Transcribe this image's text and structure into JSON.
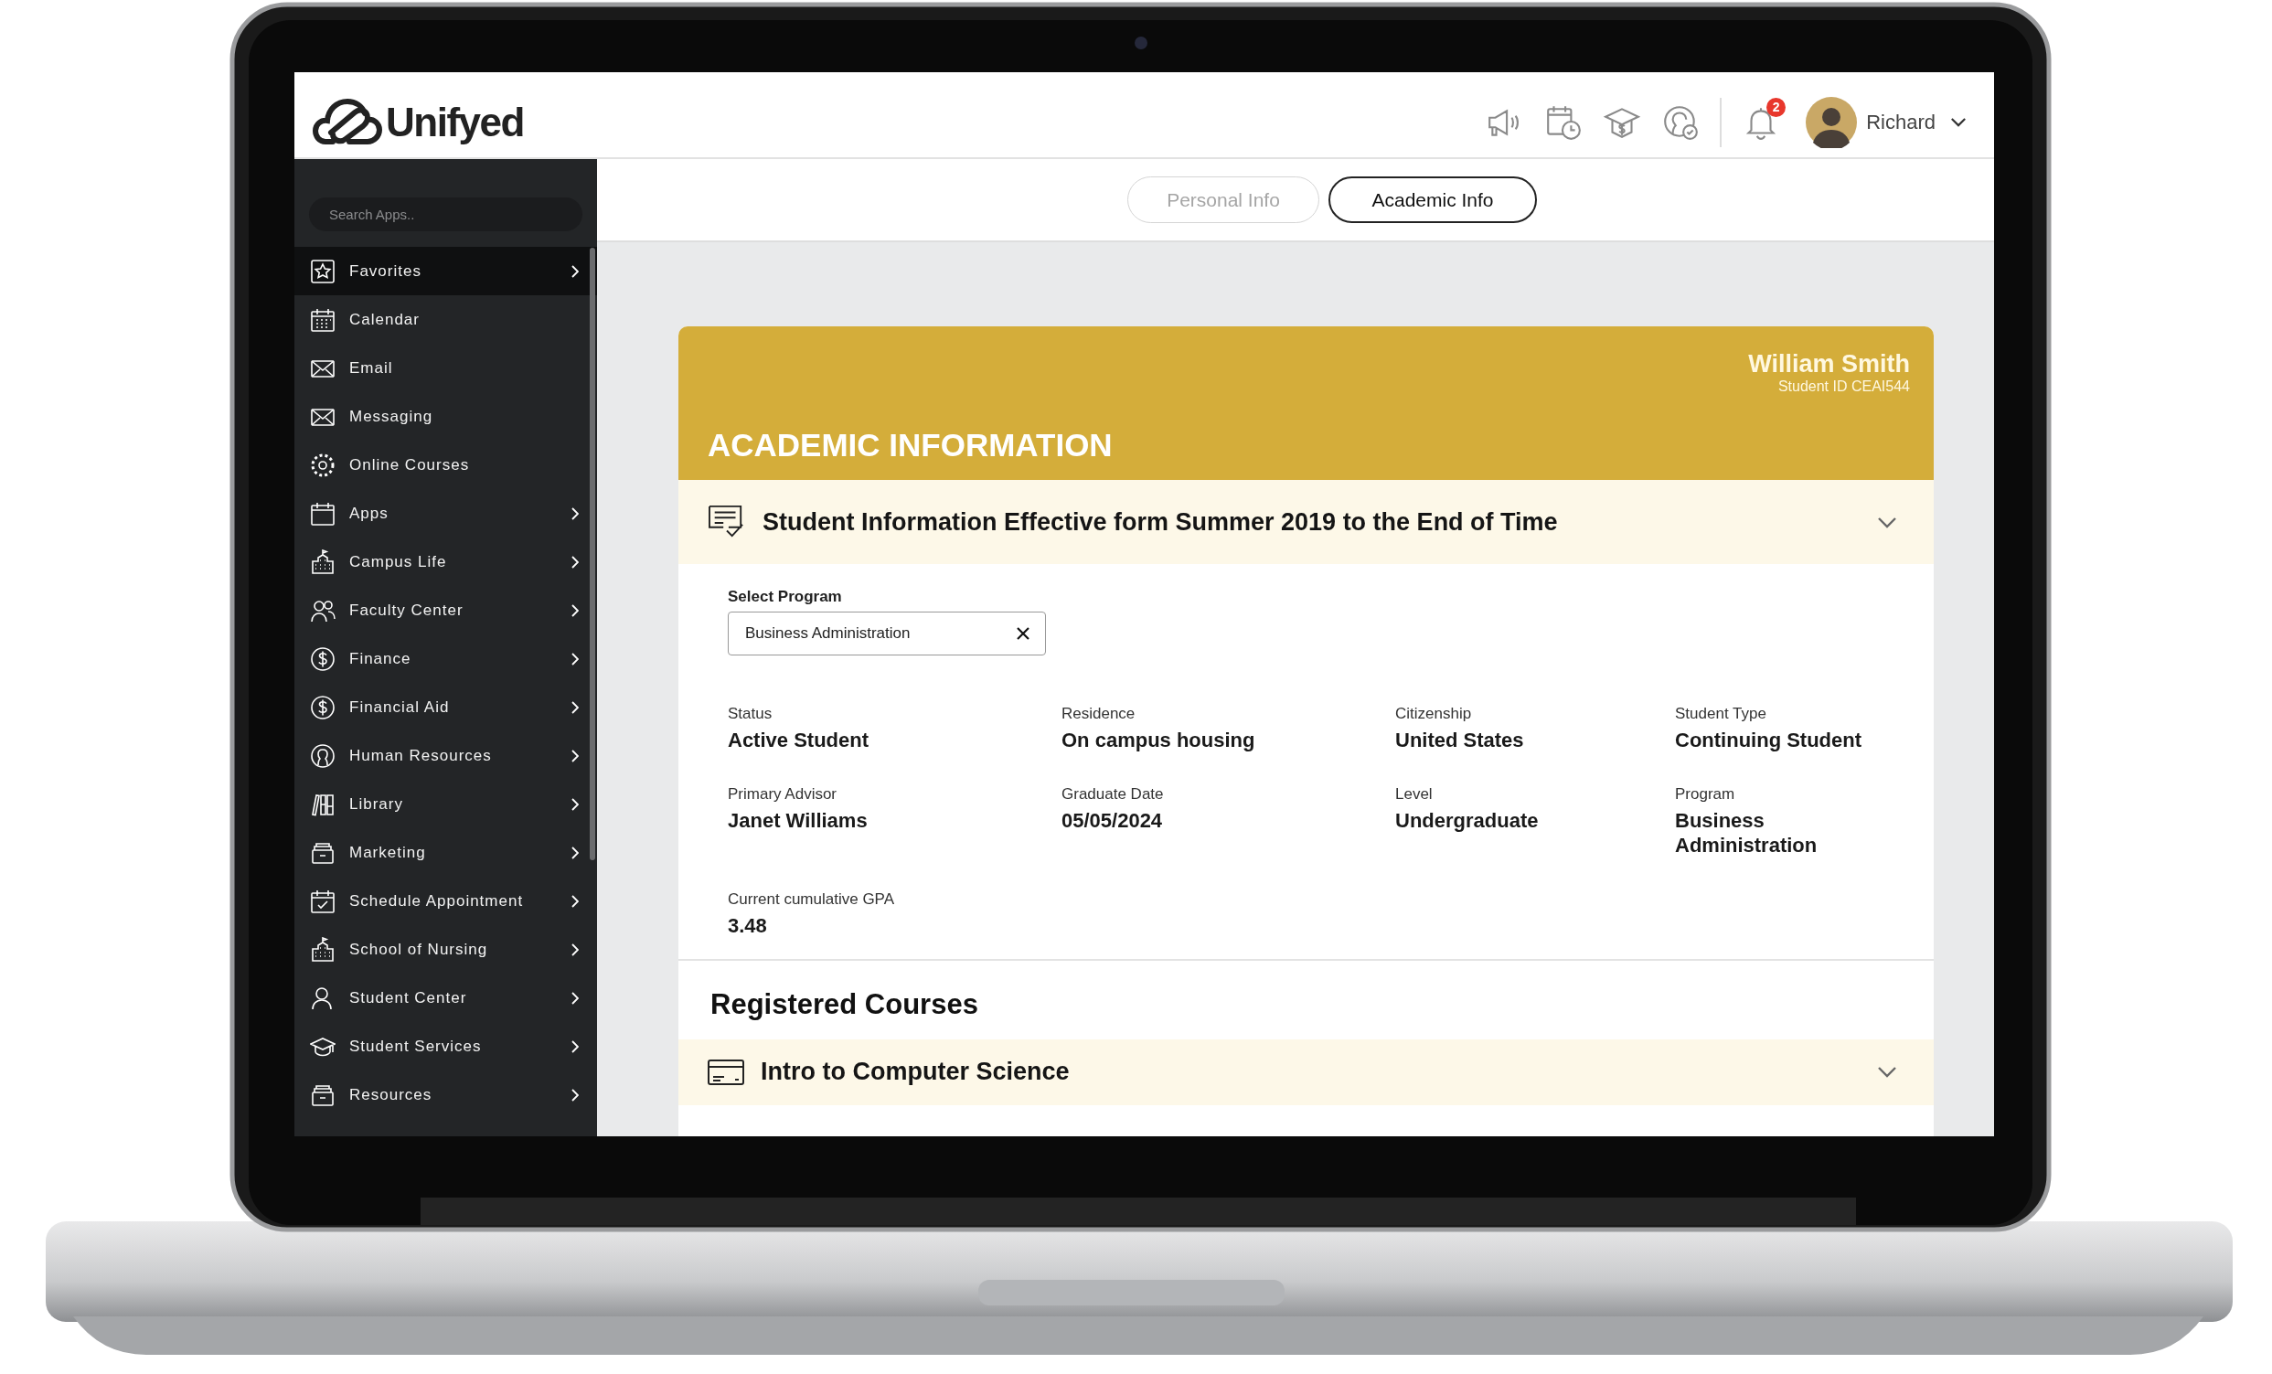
{
  "header": {
    "logo_text": "Unifyed",
    "notification_count": "2",
    "user_name": "Richard"
  },
  "sidebar": {
    "search": {
      "placeholder": "Search Apps.."
    },
    "items": [
      {
        "label": "Favorites",
        "selected": true,
        "has_submenu": true
      },
      {
        "label": "Calendar",
        "selected": false,
        "has_submenu": false
      },
      {
        "label": "Email",
        "selected": false,
        "has_submenu": false
      },
      {
        "label": "Messaging",
        "selected": false,
        "has_submenu": false
      },
      {
        "label": "Online Courses",
        "selected": false,
        "has_submenu": false
      },
      {
        "label": "Apps",
        "selected": false,
        "has_submenu": true
      },
      {
        "label": "Campus Life",
        "selected": false,
        "has_submenu": true
      },
      {
        "label": "Faculty Center",
        "selected": false,
        "has_submenu": true
      },
      {
        "label": "Finance",
        "selected": false,
        "has_submenu": true
      },
      {
        "label": "Financial Aid",
        "selected": false,
        "has_submenu": true
      },
      {
        "label": "Human Resources",
        "selected": false,
        "has_submenu": true
      },
      {
        "label": "Library",
        "selected": false,
        "has_submenu": true
      },
      {
        "label": "Marketing",
        "selected": false,
        "has_submenu": true
      },
      {
        "label": "Schedule Appointment",
        "selected": false,
        "has_submenu": true
      },
      {
        "label": "School of Nursing",
        "selected": false,
        "has_submenu": true
      },
      {
        "label": "Student Center",
        "selected": false,
        "has_submenu": true
      },
      {
        "label": "Student Services",
        "selected": false,
        "has_submenu": true
      },
      {
        "label": "Resources",
        "selected": false,
        "has_submenu": true
      }
    ]
  },
  "tabs": [
    {
      "label": "Personal Info",
      "selected": false
    },
    {
      "label": "Academic Info",
      "selected": true
    }
  ],
  "card": {
    "title": "ACADEMIC INFORMATION",
    "student_name": "William Smith",
    "student_id": "Student ID CEAI544",
    "section_title": "Student Information Effective form Summer 2019 to the End of Time",
    "select_program": {
      "label": "Select Program",
      "value": "Business Administration"
    },
    "fields": [
      {
        "label": "Status",
        "value": "Active Student"
      },
      {
        "label": "Residence",
        "value": "On campus housing"
      },
      {
        "label": "Citizenship",
        "value": "United States"
      },
      {
        "label": "Student Type",
        "value": "Continuing Student"
      },
      {
        "label": "Primary Advisor",
        "value": "Janet Williams"
      },
      {
        "label": "Graduate Date",
        "value": "05/05/2024"
      },
      {
        "label": "Level",
        "value": "Undergraduate"
      },
      {
        "label": "Program",
        "value": "Business Administration"
      },
      {
        "label": "Current cumulative GPA",
        "value": "3.48"
      }
    ],
    "courses_heading": "Registered Courses",
    "courses": [
      {
        "title": "Intro to Computer Science"
      }
    ]
  }
}
